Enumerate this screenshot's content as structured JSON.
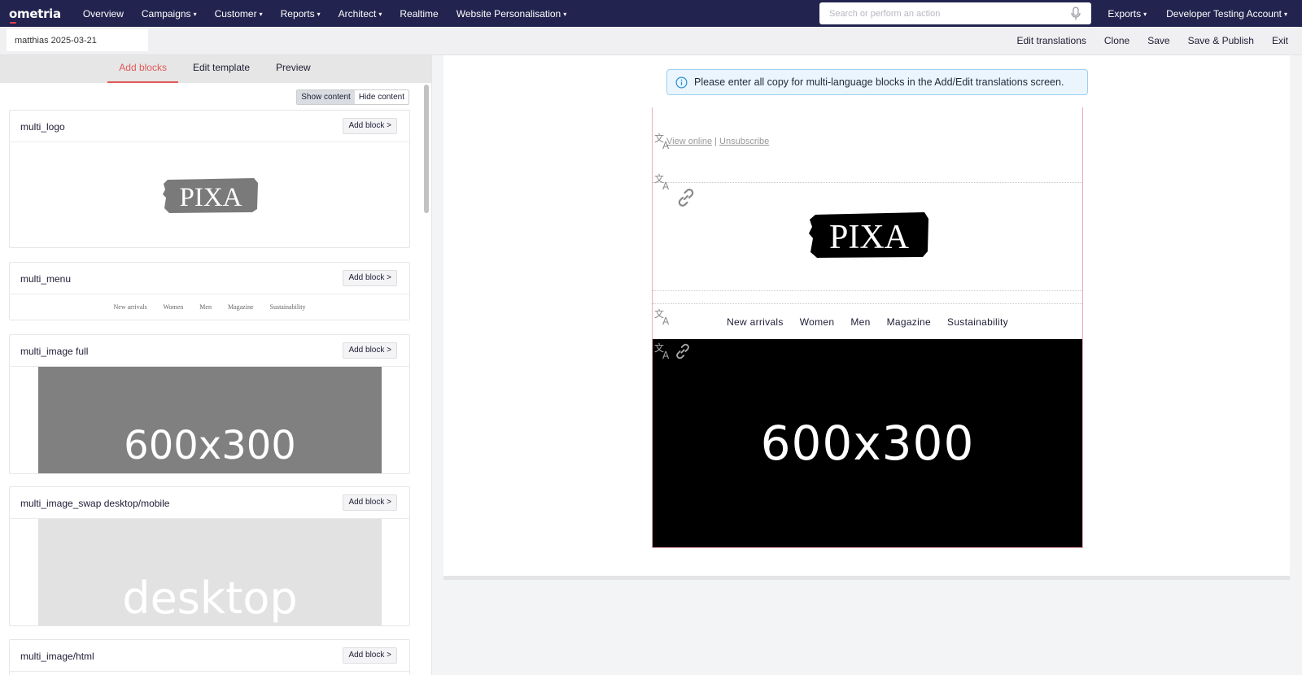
{
  "nav": {
    "logo": "ometria",
    "items": [
      {
        "label": "Overview",
        "caret": false
      },
      {
        "label": "Campaigns",
        "caret": true
      },
      {
        "label": "Customer",
        "caret": true
      },
      {
        "label": "Reports",
        "caret": true
      },
      {
        "label": "Architect",
        "caret": true
      },
      {
        "label": "Realtime",
        "caret": false
      },
      {
        "label": "Website Personalisation",
        "caret": true
      }
    ],
    "search_placeholder": "Search or perform an action",
    "exports": "Exports",
    "account": "Developer Testing Account",
    "caret_glyph": "▾"
  },
  "actionbar": {
    "template_name": "matthias 2025-03-21",
    "edit_translations": "Edit translations",
    "clone": "Clone",
    "save": "Save",
    "save_publish": "Save & Publish",
    "exit": "Exit"
  },
  "left": {
    "tabs": [
      {
        "label": "Add blocks",
        "active": true
      },
      {
        "label": "Edit template",
        "active": false
      },
      {
        "label": "Preview",
        "active": false
      }
    ],
    "show_content": "Show content",
    "hide_content": "Hide content",
    "add_block_label": "Add block >",
    "blocks": [
      {
        "title": "multi_logo",
        "logo_text": "PIXA"
      },
      {
        "title": "multi_menu",
        "menu": [
          "New arrivals",
          "Women",
          "Men",
          "Magazine",
          "Sustainability"
        ]
      },
      {
        "title": "multi_image full",
        "placeholder": "600x300"
      },
      {
        "title": "multi_image_swap desktop/mobile",
        "placeholder": "desktop"
      },
      {
        "title": "multi_image/html"
      }
    ],
    "colors": {
      "image_full_bg": "#808080",
      "image_swap_bg": "#e2e2e2"
    }
  },
  "preview": {
    "info": "Please enter all copy for multi-language blocks in the Add/Edit translations screen.",
    "view_online": "View online",
    "separator": "|",
    "unsubscribe": "Unsubscribe",
    "logo_text": "PIXA",
    "menu": [
      "New arrivals",
      "Women",
      "Men",
      "Magazine",
      "Sustainability"
    ],
    "hero_placeholder": "600x300"
  },
  "colors": {
    "nav_bg": "#22234e",
    "accent": "#e25a5a",
    "info_bg": "#eaf5fd",
    "info_border": "#9fd0f0",
    "block_border": "#f1aab3"
  },
  "icons": [
    "microphone-icon",
    "info-icon",
    "translate-icon",
    "link-icon",
    "caret-down-icon"
  ]
}
